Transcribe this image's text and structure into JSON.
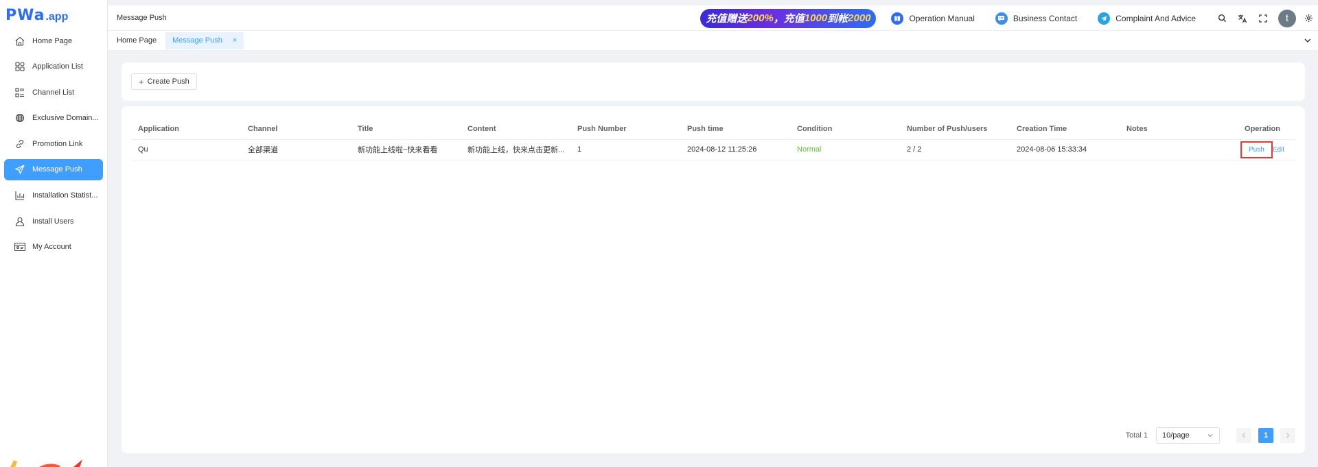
{
  "brand": {
    "logo_main": "PWa",
    "logo_suffix": ".app",
    "accent": "#409eff",
    "logo_color": "#2f6cf6"
  },
  "sidebar": {
    "items": [
      {
        "label": "Home Page",
        "icon": "home-icon"
      },
      {
        "label": "Application List",
        "icon": "grid-icon"
      },
      {
        "label": "Channel List",
        "icon": "list-icon"
      },
      {
        "label": "Exclusive Domain...",
        "icon": "globe-icon"
      },
      {
        "label": "Promotion Link",
        "icon": "link-icon"
      },
      {
        "label": "Message Push",
        "icon": "send-icon",
        "active": true
      },
      {
        "label": "Installation Statist...",
        "icon": "chart-icon"
      },
      {
        "label": "Install Users",
        "icon": "user-icon"
      },
      {
        "label": "My Account",
        "icon": "id-card-icon"
      }
    ]
  },
  "header": {
    "breadcrumb": "Message Push",
    "banner": {
      "p1": "充值赠送",
      "p2": "200%",
      "p3": "，充值",
      "p4": "1000",
      "p5": "到帐",
      "p6": "2000"
    },
    "links": {
      "manual": "Operation Manual",
      "contact": "Business Contact",
      "complaint": "Complaint And Advice"
    },
    "avatar_initial": "t"
  },
  "tabs": [
    {
      "label": "Home Page"
    },
    {
      "label": "Message Push",
      "active": true,
      "close": "×"
    }
  ],
  "toolbar": {
    "create_label": "Create Push"
  },
  "table": {
    "columns": [
      "Application",
      "Channel",
      "Title",
      "Content",
      "Push Number",
      "Push time",
      "Condition",
      "Number of Push/users",
      "Creation Time",
      "Notes",
      "Operation"
    ],
    "rows": [
      {
        "application": "Qu",
        "channel": "全部渠道",
        "title": "新功能上线啦~快来看看",
        "content": "新功能上线，快来点击更新...",
        "push_number": "1",
        "push_time": "2024-08-12 11:25:26",
        "condition": "Normal",
        "push_users": "2 / 2",
        "creation_time": "2024-08-06 15:33:34",
        "notes": "",
        "op_push": "Push",
        "op_edit": "Edit"
      }
    ]
  },
  "pagination": {
    "total": "Total 1",
    "page_size": "10/page",
    "current_page": "1"
  }
}
